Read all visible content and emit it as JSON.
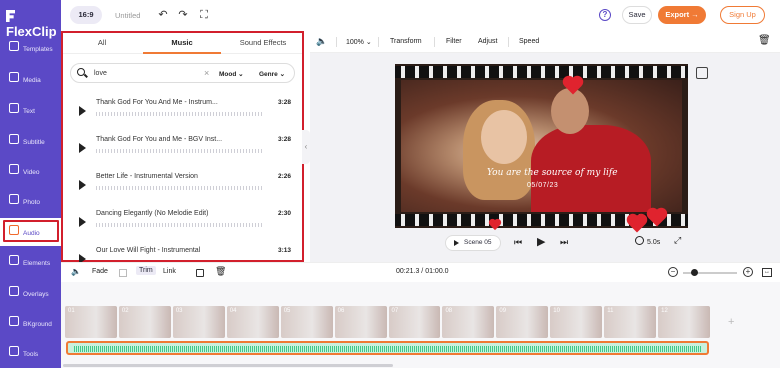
{
  "app": {
    "logo": "FlexClip",
    "ratio": "16:9",
    "project_name": "Untitled"
  },
  "topbar": {
    "help": "?",
    "save": "Save",
    "export": "Export →",
    "signup": "Sign Up"
  },
  "sidebar": {
    "items": [
      {
        "label": "Templates"
      },
      {
        "label": "Media"
      },
      {
        "label": "Text"
      },
      {
        "label": "Subtitle"
      },
      {
        "label": "Video"
      },
      {
        "label": "Photo"
      },
      {
        "label": "Audio"
      },
      {
        "label": "Elements"
      },
      {
        "label": "Overlays"
      },
      {
        "label": "BKground"
      },
      {
        "label": "Tools"
      }
    ]
  },
  "panel": {
    "tabs": [
      "All",
      "Music",
      "Sound Effects"
    ],
    "search_value": "love",
    "mood": "Mood",
    "genre": "Genre",
    "tracks": [
      {
        "title": "Thank God For You And Me - Instrum...",
        "duration": "3:28"
      },
      {
        "title": "Thank God For You and Me - BGV Inst...",
        "duration": "3:28"
      },
      {
        "title": "Better Life - Instrumental Version",
        "duration": "2:26"
      },
      {
        "title": "Dancing Elegantly (No Melodie Edit)",
        "duration": "2:30"
      },
      {
        "title": "Our Love Will Fight - Instrumental",
        "duration": "3:13"
      }
    ]
  },
  "editbar": {
    "zoom": "100%",
    "transform": "Transform",
    "filter": "Filter",
    "adjust": "Adjust",
    "speed": "Speed"
  },
  "canvas": {
    "overlay_text": "You are the source of my life",
    "overlay_date": "05/07/23",
    "scene": "Scene 05",
    "duration": "5.0s"
  },
  "timeline": {
    "fade": "Fade",
    "trim": "Trim",
    "link": "Link",
    "time": "00:21.3 / 01:00.0",
    "clips": [
      "01",
      "02",
      "03",
      "04",
      "05",
      "06",
      "07",
      "08",
      "09",
      "10",
      "11",
      "12"
    ]
  },
  "colors": {
    "brand": "#5b49c6",
    "accent": "#f07a35",
    "highlight": "#d21f2c"
  }
}
